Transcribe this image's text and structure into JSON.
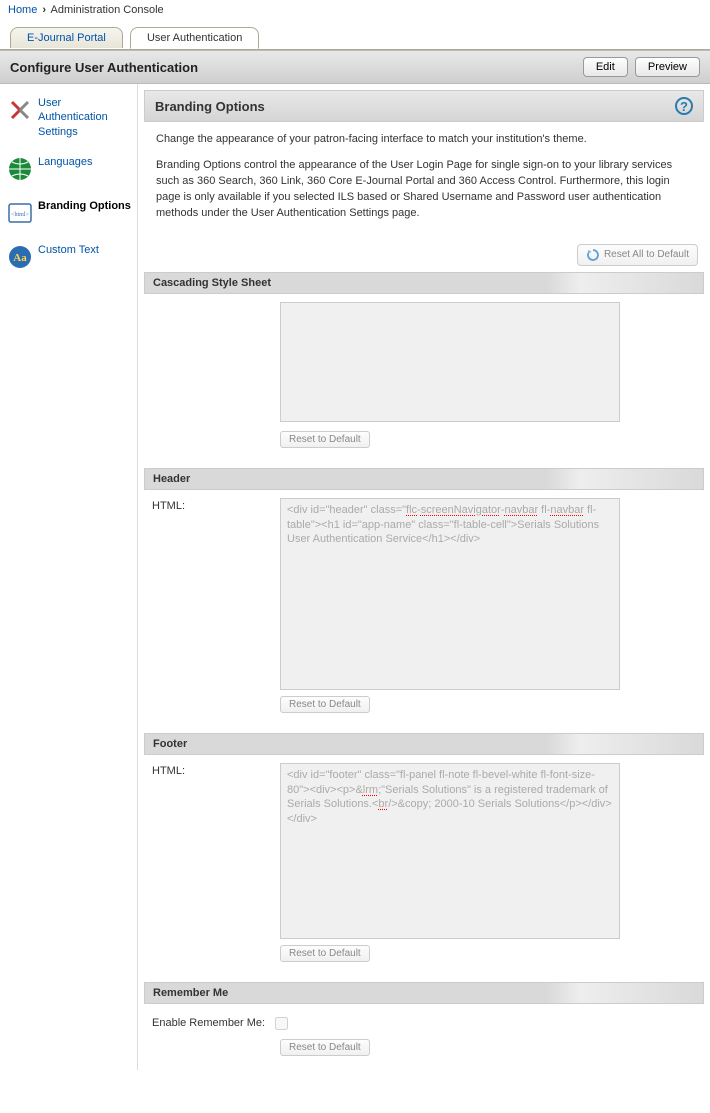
{
  "breadcrumb": {
    "home": "Home",
    "current": "Administration Console"
  },
  "tabs": {
    "t0": "E-Journal Portal",
    "t1": "User Authentication"
  },
  "header": {
    "title": "Configure User Authentication",
    "edit": "Edit",
    "preview": "Preview"
  },
  "sidebar": {
    "s0": "User Authentication Settings",
    "s1": "Languages",
    "s2": "Branding Options",
    "s3": "Custom Text"
  },
  "page": {
    "title": "Branding Options",
    "intro1": "Change the appearance of your patron-facing interface to match your institution's theme.",
    "intro2": "Branding Options control the appearance of the User Login Page for single sign-on to your library services such as 360 Search, 360 Link, 360 Core E-Journal Portal and 360 Access Control. Furthermore, this login page is only available if you selected ILS based or Shared Username and Password user authentication methods under the User Authentication Settings page.",
    "reset_all": "Reset All to Default"
  },
  "css": {
    "heading": "Cascading Style Sheet",
    "reset": "Reset to Default"
  },
  "headerSec": {
    "heading": "Header",
    "label": "HTML:",
    "value": "<div id=\"header\" class=\"flc-screenNavigator-navbar fl-navbar fl-table\"><h1 id=\"app-name\" class=\"fl-table-cell\">Serials Solutions User Authentication Service</h1></div>",
    "reset": "Reset to Default"
  },
  "footerSec": {
    "heading": "Footer",
    "label": "HTML:",
    "value": "<div id=\"footer\" class=\"fl-panel fl-note fl-bevel-white fl-font-size-80\"><div><p>&lrm;\"Serials Solutions\" is a registered trademark of Serials Solutions.<br/>&copy; 2000-10 Serials Solutions</p></div></div>",
    "reset": "Reset to Default"
  },
  "remember": {
    "heading": "Remember Me",
    "label": "Enable Remember Me:",
    "reset": "Reset to Default"
  }
}
